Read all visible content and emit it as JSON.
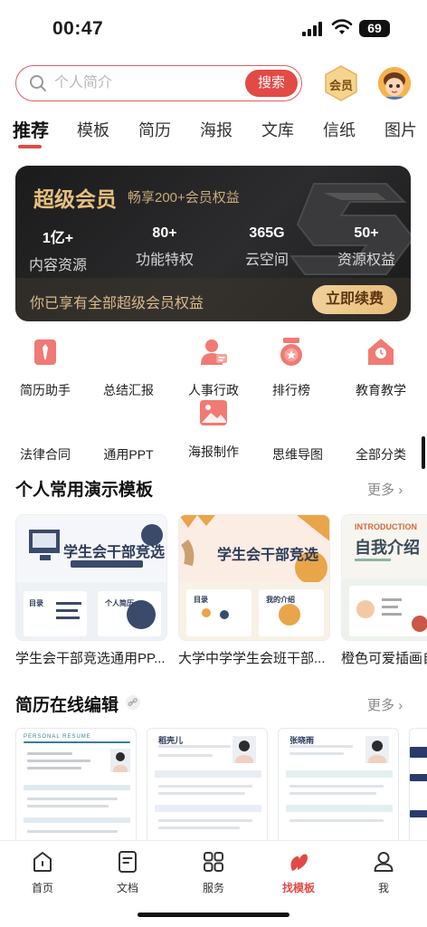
{
  "status": {
    "time": "00:47",
    "battery": "69"
  },
  "search": {
    "placeholder": "个人简介",
    "button": "搜索"
  },
  "vip_badge": "会员",
  "tabs": [
    "推荐",
    "模板",
    "简历",
    "海报",
    "文库",
    "信纸",
    "图片"
  ],
  "vip_card": {
    "title": "超级会员",
    "subtitle": "畅享200+会员权益",
    "stats": [
      {
        "value": "1亿+",
        "label": "内容资源"
      },
      {
        "value": "80+",
        "label": "功能特权"
      },
      {
        "value": "365G",
        "label": "云空间"
      },
      {
        "value": "50+",
        "label": "资源权益"
      }
    ],
    "footer": "你已享有全部超级会员权益",
    "renew": "立即续费"
  },
  "grid": [
    {
      "label": "简历助手",
      "icon": "resume-tie-icon"
    },
    {
      "label": "总结汇报",
      "icon": "chart-report-icon"
    },
    {
      "label": "人事行政",
      "icon": "person-hr-icon"
    },
    {
      "label": "排行榜",
      "icon": "medal-icon"
    },
    {
      "label": "教育教学",
      "icon": "school-icon"
    },
    {
      "label": "法律合同",
      "icon": "contract-icon"
    },
    {
      "label": "通用PPT",
      "icon": "ppt-icon"
    },
    {
      "label": "海报制作",
      "icon": "poster-image-icon"
    },
    {
      "label": "思维导图",
      "icon": "mindmap-icon"
    },
    {
      "label": "全部分类",
      "icon": "all-categories-icon"
    }
  ],
  "ppt_section": {
    "title": "个人常用演示模板",
    "more": "更多",
    "items": [
      {
        "name": "学生会干部竞选通用PP...",
        "thumb_title": "学生会干部竞选",
        "thumb_small": "目录",
        "thumb_small2": "个人简历"
      },
      {
        "name": "大学中学学生会班干部...",
        "thumb_title": "学生会干部竞选",
        "thumb_small": "目录",
        "thumb_small2": "我的介绍"
      },
      {
        "name": "橙色可爱插画自",
        "thumb_top": "INTRODUCTION",
        "thumb_title": "自我介绍"
      }
    ]
  },
  "resume_section": {
    "title": "简历在线编辑",
    "more": "更多",
    "items": [
      {
        "header": "PERSONAL RESUME"
      },
      {
        "header": "稻壳儿"
      },
      {
        "header": "张晓雨"
      }
    ]
  },
  "nav": [
    {
      "label": "首页",
      "icon": "home-icon"
    },
    {
      "label": "文档",
      "icon": "document-icon"
    },
    {
      "label": "服务",
      "icon": "services-grid-icon"
    },
    {
      "label": "找模板",
      "icon": "template-leaf-icon"
    },
    {
      "label": "我",
      "icon": "profile-icon"
    }
  ],
  "colors": {
    "accent": "#e24a45",
    "gold": "#e6c07e",
    "card_bg": "#1f1f20"
  }
}
